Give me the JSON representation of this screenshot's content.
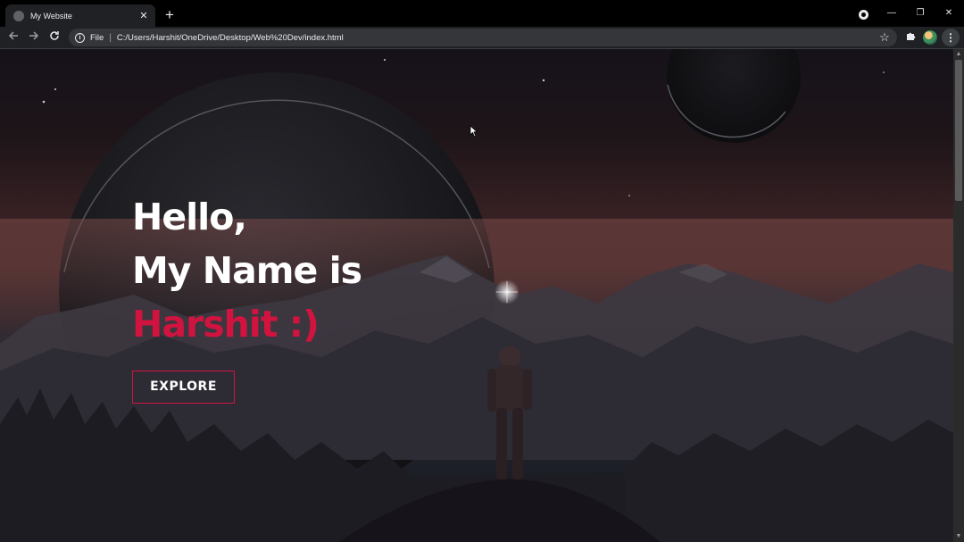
{
  "browser": {
    "tab_title": "My Website",
    "tab_close": "✕",
    "new_tab": "+",
    "url_scheme": "File",
    "url_separator": "|",
    "url": "C:/Users/Harshit/OneDrive/Desktop/Web%20Dev/index.html",
    "window_controls": {
      "minimize": "—",
      "restore": "❐",
      "close": "✕"
    },
    "icons": {
      "back": "back-arrow-icon",
      "forward": "forward-arrow-icon",
      "reload": "reload-icon",
      "info": "info-icon",
      "bookmark": "star-icon",
      "extensions": "puzzle-icon",
      "menu": "kebab-menu-icon"
    }
  },
  "hero": {
    "line1": "Hello,",
    "line2": "My Name is",
    "name": "Harshit :)",
    "button_label": "EXPLORE"
  },
  "colors": {
    "accent": "#d0143f",
    "heading": "#ffffff",
    "browser_frame": "#202124"
  }
}
